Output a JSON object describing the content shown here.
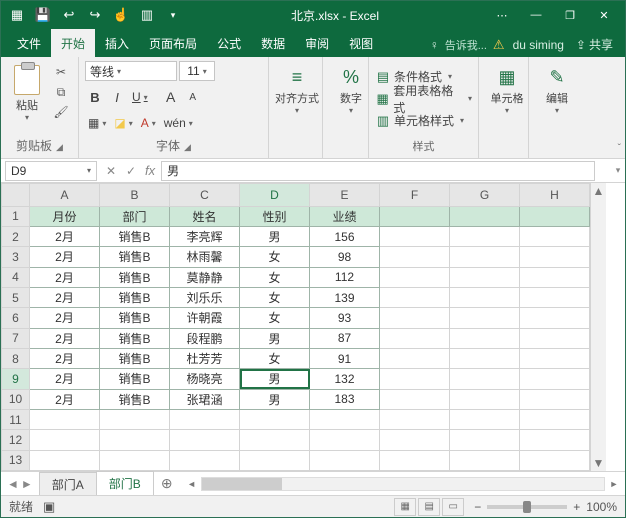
{
  "title": "北京.xlsx - Excel",
  "qat": {
    "save": "💾",
    "undo": "↩",
    "redo": "↪",
    "touch": "☝",
    "custom": "▥"
  },
  "win": {
    "opts": "⋯",
    "min": "—",
    "max": "❐",
    "close": "✕"
  },
  "tabs": [
    "文件",
    "开始",
    "插入",
    "页面布局",
    "公式",
    "数据",
    "审阅",
    "视图"
  ],
  "active_tab": 1,
  "tell": "告诉我...",
  "user": "du siming",
  "share": "共享",
  "ribbon": {
    "paste": "粘贴",
    "clipboard_group": "剪贴板",
    "font_name": "等线",
    "font_size": "11",
    "font_group": "字体",
    "bold": "B",
    "italic": "I",
    "underline": "U",
    "grow": "A",
    "shrink": "A",
    "border": "▦",
    "fill": "◪",
    "color": "A",
    "phonetic": "wén",
    "align_group": "对齐方式",
    "number_group": "数字",
    "number_sym": "%",
    "styles_group": "样式",
    "cond": "条件格式",
    "table": "套用表格格式",
    "cell": "单元格样式",
    "cells_group": "单元格",
    "edit_group": "编辑"
  },
  "namebox": "D9",
  "formula": "男",
  "fx": "fx",
  "columns": [
    "A",
    "B",
    "C",
    "D",
    "E",
    "F",
    "G",
    "H"
  ],
  "sel_col": 3,
  "sel_row": 9,
  "row_count": 13,
  "headers": [
    "月份",
    "部门",
    "姓名",
    "性别",
    "业绩"
  ],
  "rows": [
    [
      "2月",
      "销售B",
      "李亮辉",
      "男",
      "156"
    ],
    [
      "2月",
      "销售B",
      "林雨馨",
      "女",
      "98"
    ],
    [
      "2月",
      "销售B",
      "莫静静",
      "女",
      "112"
    ],
    [
      "2月",
      "销售B",
      "刘乐乐",
      "女",
      "139"
    ],
    [
      "2月",
      "销售B",
      "许朝霞",
      "女",
      "93"
    ],
    [
      "2月",
      "销售B",
      "段程鹏",
      "男",
      "87"
    ],
    [
      "2月",
      "销售B",
      "杜芳芳",
      "女",
      "91"
    ],
    [
      "2月",
      "销售B",
      "杨晓亮",
      "男",
      "132"
    ],
    [
      "2月",
      "销售B",
      "张珺涵",
      "男",
      "183"
    ]
  ],
  "sheets": [
    "部门A",
    "部门B"
  ],
  "active_sheet": 1,
  "status": {
    "ready": "就绪",
    "zoom": "100%",
    "plus": "+",
    "minus": "−"
  }
}
